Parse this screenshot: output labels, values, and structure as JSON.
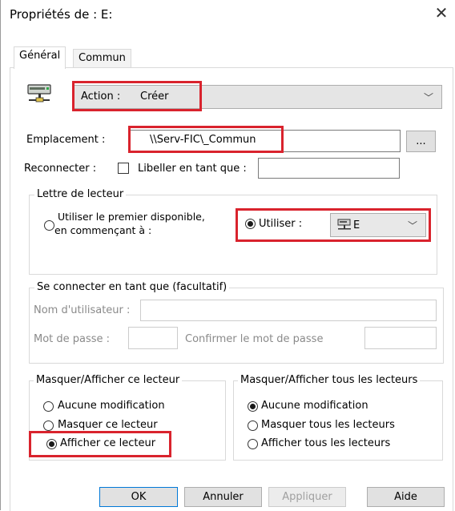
{
  "window": {
    "title": "Propriétés de : E:"
  },
  "tabs": [
    {
      "label": "Général"
    },
    {
      "label": "Commun"
    }
  ],
  "action": {
    "label": "Action :",
    "value": "Créer"
  },
  "location": {
    "label": "Emplacement :",
    "value": "\\\\Serv-FIC\\_Commun",
    "browse": "..."
  },
  "reconnect": {
    "label": "Reconnecter :",
    "checked": false,
    "libel_label": "Libeller en tant que :",
    "libel_value": ""
  },
  "drive_letter": {
    "title": "Lettre de lecteur",
    "first_available_line1": "Utiliser le premier disponible,",
    "first_available_line2": "en commençant à :",
    "use_label": "Utiliser :",
    "use_value": "E"
  },
  "connect_as": {
    "title": "Se connecter en tant que (facultatif)",
    "username_label": "Nom d'utilisateur :",
    "password_label": "Mot de passe :",
    "confirm_label": "Confirmer le mot de passe"
  },
  "hide_show_this": {
    "title": "Masquer/Afficher ce lecteur",
    "options": [
      "Aucune modification",
      "Masquer ce lecteur",
      "Afficher ce lecteur"
    ],
    "selected": 2
  },
  "hide_show_all": {
    "title": "Masquer/Afficher tous les lecteurs",
    "options": [
      "Aucune modification",
      "Masquer tous les lecteurs",
      "Afficher tous les lecteurs"
    ],
    "selected": 0
  },
  "buttons": {
    "ok": "OK",
    "cancel": "Annuler",
    "apply": "Appliquer",
    "help": "Aide"
  },
  "colors": {
    "highlight": "#d9232d",
    "default_button": "#0078d7"
  },
  "icons": {
    "close": "close-icon",
    "drive": "network-drive-icon",
    "dropdown": "chevron-down-icon"
  }
}
